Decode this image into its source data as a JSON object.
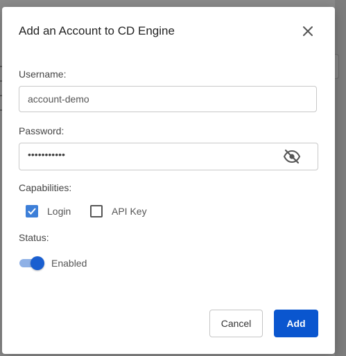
{
  "dialog": {
    "title": "Add an Account to CD Engine",
    "close_icon": "close-icon"
  },
  "username": {
    "label": "Username:",
    "value": "account-demo"
  },
  "password": {
    "label": "Password:",
    "masked_value": "•••••••••••",
    "visibility_icon": "eye-off-icon"
  },
  "capabilities": {
    "label": "Capabilities:",
    "options": [
      {
        "label": "Login",
        "checked": true
      },
      {
        "label": "API Key",
        "checked": false
      }
    ]
  },
  "status": {
    "label": "Status:",
    "toggle_label": "Enabled",
    "enabled": true
  },
  "actions": {
    "cancel_label": "Cancel",
    "add_label": "Add"
  },
  "colors": {
    "primary": "#0a56cf",
    "checkbox_checked": "#3d7fd8",
    "toggle_track": "#8fb1e6",
    "toggle_thumb": "#1a5fd0"
  }
}
